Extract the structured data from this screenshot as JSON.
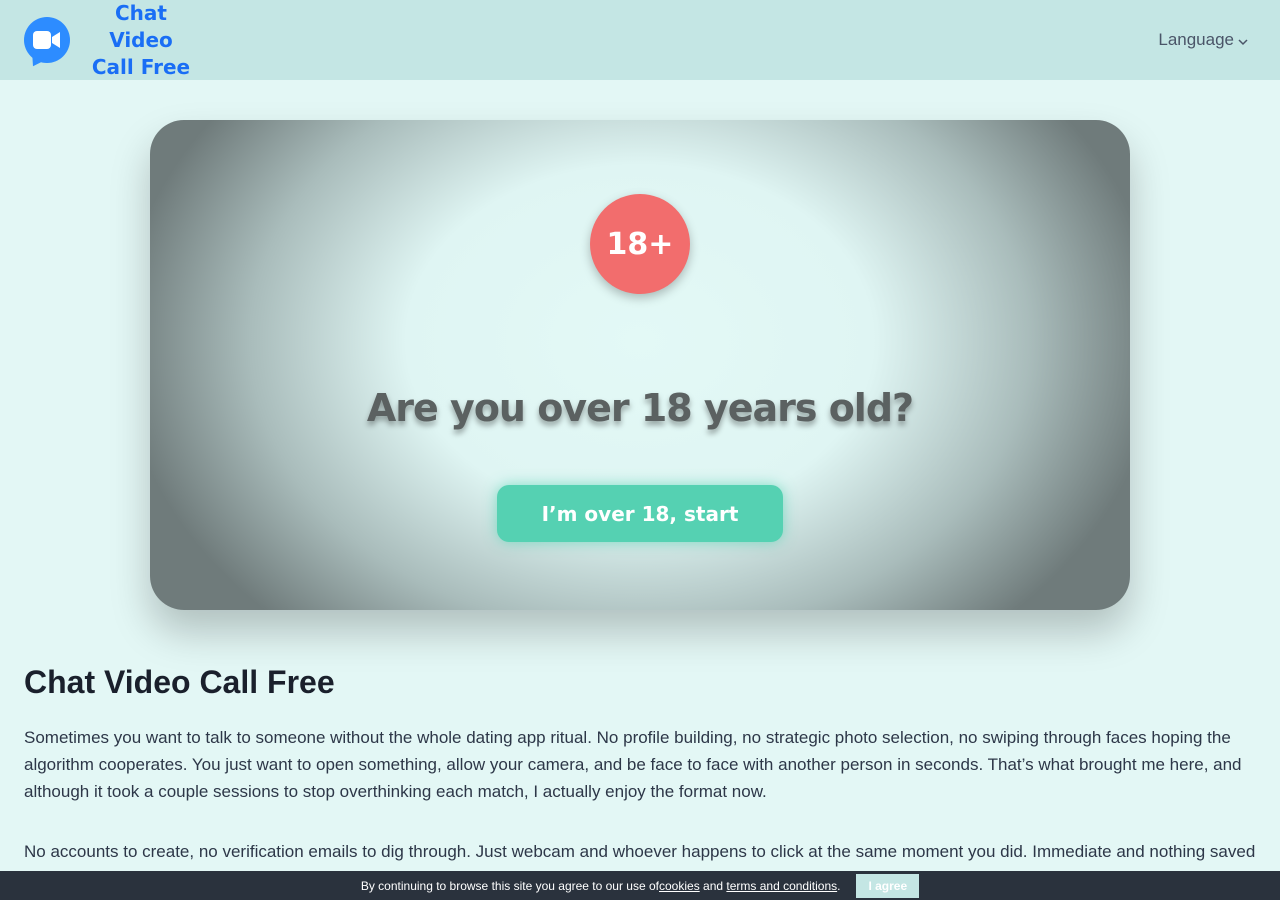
{
  "header": {
    "logo_line1": "Chat Video",
    "logo_line2": "Call Free",
    "language_label": "Language"
  },
  "hero": {
    "badge": "18+",
    "question": "Are you over 18 years old?",
    "start_button": "I’m over 18, start"
  },
  "content": {
    "title": "Chat Video Call Free",
    "paragraph1": "Sometimes you want to talk to someone without the whole dating app ritual. No profile building, no strategic photo selection, no swiping through faces hoping the algorithm cooperates. You just want to open something, allow your camera, and be face to face with another person in seconds. That’s what brought me here, and although it took a couple sessions to stop overthinking each match, I actually enjoy the format now.",
    "paragraph2": "No accounts to create, no verification emails to dig through. Just webcam and whoever happens to click at the same moment you did. Immediate and nothing saved afterward. That's the kind of connection I wanted — not a substitute for a relationship, just a real conversation with a real person."
  },
  "cookie": {
    "text_before": "By continuing to browse this site you agree to our use of ",
    "cookies_link": "cookies",
    "text_mid": " and ",
    "terms_link": "terms and conditions",
    "text_end": ".",
    "agree_button": "I agree"
  },
  "colors": {
    "header_bg": "#c4e6e4",
    "page_bg": "#e3f7f5",
    "brand_blue": "#1a6ef5",
    "badge_red": "#f26d6d",
    "button_green": "#55d1b2",
    "cookie_bar": "#2a323d"
  },
  "icons": {
    "logo": "video-chat-bubble-icon",
    "language_caret": "chevron-down-icon"
  }
}
